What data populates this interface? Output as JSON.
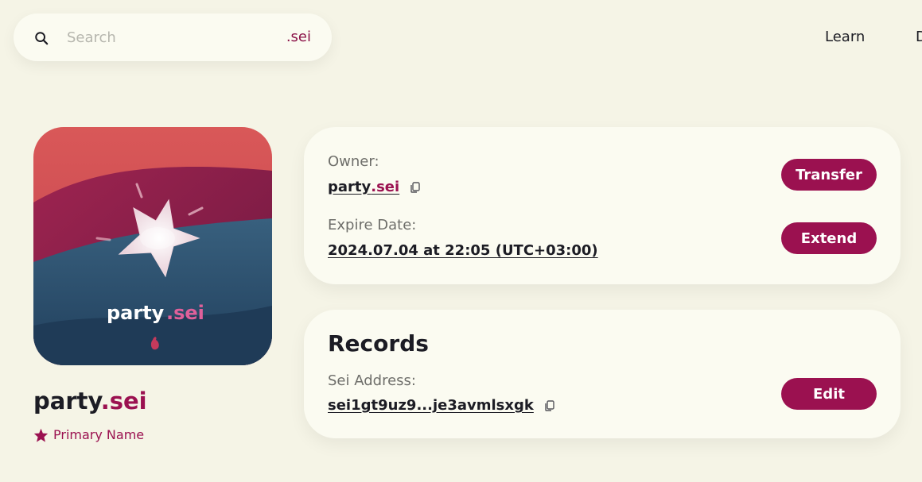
{
  "search": {
    "placeholder": "Search",
    "tld": ".sei",
    "icon": "search-icon"
  },
  "nav": {
    "learn": "Learn",
    "next_partial": "D"
  },
  "nft": {
    "name": "party",
    "tld": ".sei",
    "colors": {
      "top": "#d85a5a",
      "mid": "#8e1c4c",
      "bottom": "#2a4e6e"
    }
  },
  "profile": {
    "name": "party",
    "tld": ".sei",
    "primary_label": "Primary Name",
    "primary_icon": "star-icon"
  },
  "ownership": {
    "owner_label": "Owner:",
    "owner_name": "party",
    "owner_tld": ".sei",
    "expire_label": "Expire Date:",
    "expire_value": "2024.07.04 at 22:05 (UTC+03:00)",
    "transfer_label": "Transfer",
    "extend_label": "Extend"
  },
  "records": {
    "title": "Records",
    "address_label": "Sei Address:",
    "address_value": "sei1gt9uz9...je3avmlsxgk",
    "edit_label": "Edit"
  },
  "colors": {
    "accent": "#9b1150",
    "background": "#f5f4e6",
    "card": "#fbfbf1"
  }
}
